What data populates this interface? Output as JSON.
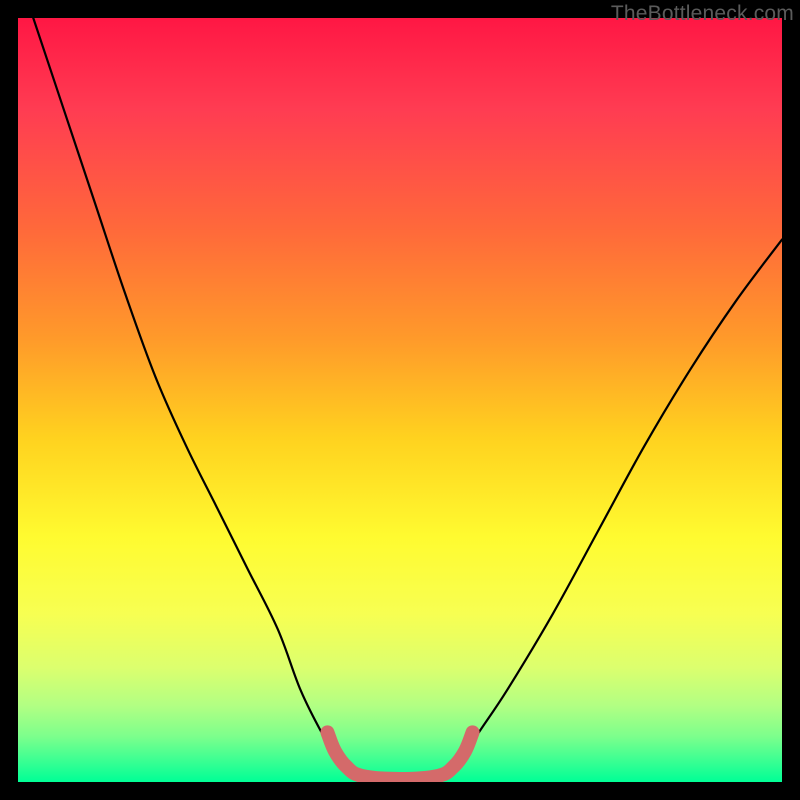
{
  "watermark": {
    "text": "TheBottleneck.com"
  },
  "chart_data": {
    "type": "line",
    "title": "",
    "xlabel": "",
    "ylabel": "",
    "x_range": [
      0,
      1
    ],
    "y_range": [
      0,
      100
    ],
    "series": [
      {
        "name": "bottleneck-curve",
        "x": [
          0.02,
          0.06,
          0.1,
          0.14,
          0.18,
          0.22,
          0.26,
          0.3,
          0.34,
          0.37,
          0.4,
          0.43,
          0.47,
          0.53,
          0.57,
          0.6,
          0.64,
          0.7,
          0.76,
          0.82,
          0.88,
          0.94,
          1.0
        ],
        "values": [
          100,
          88,
          76,
          64,
          53,
          44,
          36,
          28,
          20,
          12,
          6,
          1,
          0,
          0,
          1,
          6,
          12,
          22,
          33,
          44,
          54,
          63,
          71
        ]
      },
      {
        "name": "sweet-spot",
        "x": [
          0.405,
          0.415,
          0.43,
          0.45,
          0.5,
          0.55,
          0.57,
          0.585,
          0.595
        ],
        "values": [
          6.5,
          4.0,
          2.0,
          0.8,
          0.4,
          0.8,
          2.0,
          4.0,
          6.5
        ]
      }
    ],
    "gradient_stops": [
      {
        "pos": 0.0,
        "color": "#ff1744"
      },
      {
        "pos": 0.12,
        "color": "#ff3c52"
      },
      {
        "pos": 0.28,
        "color": "#ff6a3a"
      },
      {
        "pos": 0.42,
        "color": "#ff9a2a"
      },
      {
        "pos": 0.55,
        "color": "#ffd21f"
      },
      {
        "pos": 0.68,
        "color": "#fffb30"
      },
      {
        "pos": 0.78,
        "color": "#f7ff52"
      },
      {
        "pos": 0.85,
        "color": "#dcff6e"
      },
      {
        "pos": 0.9,
        "color": "#b2ff83"
      },
      {
        "pos": 0.94,
        "color": "#7dff8c"
      },
      {
        "pos": 0.97,
        "color": "#3fff92"
      },
      {
        "pos": 1.0,
        "color": "#00ff96"
      }
    ],
    "curve_color": "#000000",
    "sweet_spot_color": "#d46a6a"
  }
}
